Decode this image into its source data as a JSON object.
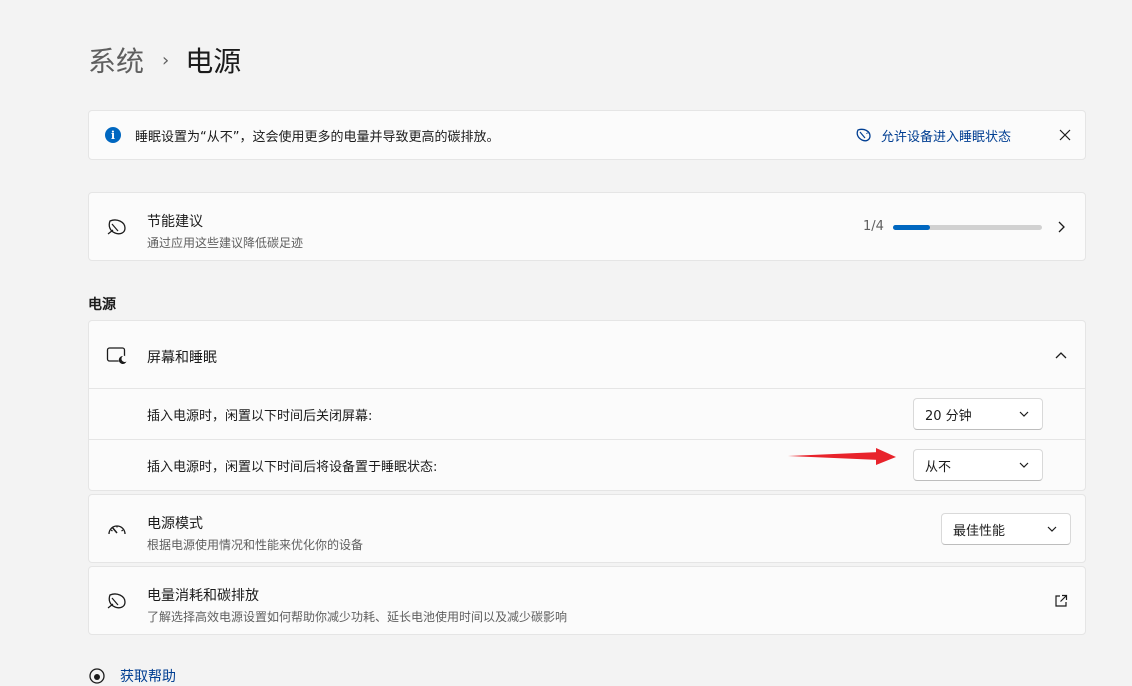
{
  "breadcrumb": {
    "parent": "系统",
    "separator": "›",
    "current": "电源"
  },
  "infobar": {
    "message": "睡眠设置为“从不”，这会使用更多的电量并导致更高的碳排放。",
    "link": "允许设备进入睡眠状态",
    "icons": {
      "info": "info-icon",
      "link": "leaf-sleep-icon",
      "close": "close-icon"
    }
  },
  "energy_recommendations": {
    "title": "节能建议",
    "subtitle": "通过应用这些建议降低碳足迹",
    "progress_text": "1/4",
    "progress_fraction": 0.25
  },
  "power_section": {
    "heading": "电源"
  },
  "screen_sleep": {
    "title": "屏幕和睡眠",
    "screen_off_label": "插入电源时，闲置以下时间后关闭屏幕:",
    "screen_off_value": "20 分钟",
    "sleep_label": "插入电源时，闲置以下时间后将设备置于睡眠状态:",
    "sleep_value": "从不"
  },
  "power_mode": {
    "title": "电源模式",
    "subtitle": "根据电源使用情况和性能来优化你的设备",
    "value": "最佳性能"
  },
  "carbon": {
    "title": "电量消耗和碳排放",
    "subtitle": "了解选择高效电源设置如何帮助你减少功耗、延长电池使用时间以及减少碳影响"
  },
  "help": {
    "label": "获取帮助"
  },
  "colors": {
    "accent": "#0067c0",
    "link": "#003e92",
    "annotation_arrow": "#e8232b",
    "background": "#f3f3f3"
  }
}
